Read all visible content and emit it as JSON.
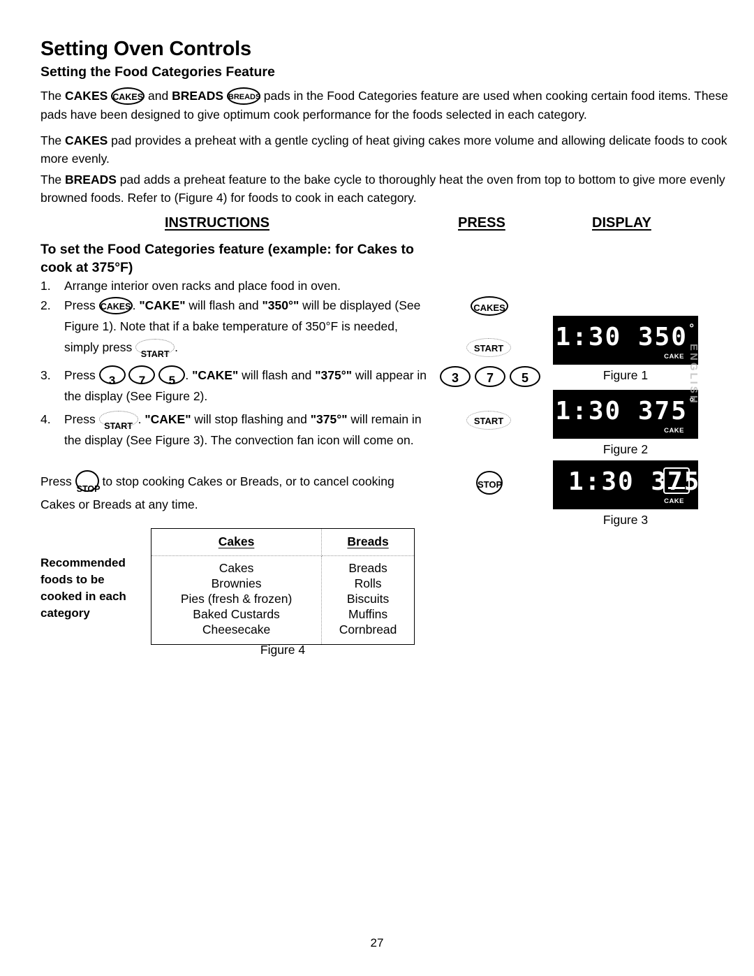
{
  "document": {
    "title": "Setting Oven Controls",
    "subtitle": "Setting the Food Categories Feature",
    "page_number": "27",
    "scan_artifact_text": "ENGLISH"
  },
  "intro": {
    "p1_a": "The ",
    "p1_cakes": "CAKES",
    "p1_pad_cakes": "CAKES",
    "p1_b": " and ",
    "p1_breads": "BREADS",
    "p1_pad_breads": "BREADS",
    "p1_c": " pads in the Food Categories feature are used when cooking certain food items. These pads have been designed to give optimum cook performance for the foods selected in each category.",
    "p2_a": "The ",
    "p2_bold": "CAKES",
    "p2_b": " pad provides a preheat with a gentle cycling of heat giving cakes more volume and allowing delicate foods to cook more evenly.",
    "p3_a": "The ",
    "p3_bold": "BREADS",
    "p3_b": " pad adds a preheat feature to the bake cycle to thoroughly heat the oven from top to bottom to give more evenly browned foods. Refer to (Figure 4) for foods to cook in each category."
  },
  "columns": {
    "instructions": "INSTRUCTIONS",
    "press": "PRESS",
    "display": "DISPLAY"
  },
  "instructions": {
    "title": "To set the Food Categories feature (example: for Cakes to cook  at 375°F)",
    "step1": {
      "num": "1.",
      "text": "Arrange interior oven racks and place food in oven."
    },
    "step2": {
      "num": "2.",
      "a": "Press ",
      "pad": "CAKES",
      "b": ". ",
      "quote1": "\"CAKE\"",
      "c": " will flash and ",
      "quote2": "\"350°\"",
      "d": " will be displayed (See Figure 1). Note that if a bake temperature of 350°F is needed, simply press ",
      "pad2": "START",
      "e": "."
    },
    "step3": {
      "num": "3.",
      "a": "Press ",
      "key1": "3",
      "key2": "7",
      "key3": "5",
      "b": ". ",
      "quote1": "\"CAKE\"",
      "c": " will flash and ",
      "quote2": "\"375°\"",
      "d": " will appear in the display (See Figure 2)."
    },
    "step4": {
      "num": "4.",
      "a": "Press ",
      "pad": "START",
      "b": ". ",
      "quote1": "\"CAKE\"",
      "c": " will stop flashing and ",
      "quote2": "\"375°\"",
      "d": "  will remain in the display (See Figure 3). The convection fan icon will come on."
    },
    "closing": {
      "a": "Press ",
      "pad": "STOP",
      "b": " to stop cooking Cakes or Breads, or to cancel cooking Cakes or Breads at any time."
    }
  },
  "press_column": {
    "cakes": "CAKES",
    "start_1": "START",
    "num_3": "3",
    "num_7": "7",
    "num_5": "5",
    "start_2": "START",
    "stop": "STOP"
  },
  "display_column": {
    "figure1": {
      "value": "1:30 350",
      "degree": "°",
      "indicator": "CAKE",
      "caption": "Figure 1",
      "fan_icon": false
    },
    "figure2": {
      "value": "1:30 375",
      "degree": "°",
      "indicator": "CAKE",
      "caption": "Figure 2",
      "fan_icon": false
    },
    "figure3": {
      "value": "1:30 375",
      "degree": "°",
      "indicator": "CAKE",
      "caption": "Figure 3",
      "fan_icon": true
    }
  },
  "figure4": {
    "row_label": "Recommended foods to be cooked in each category",
    "headers": [
      "Cakes",
      "Breads"
    ],
    "cakes_items": [
      "Cakes",
      "Brownies",
      "Pies (fresh & frozen)",
      "Baked Custards",
      "Cheesecake"
    ],
    "breads_items": [
      "Breads",
      "Rolls",
      "Biscuits",
      "Muffins",
      "Cornbread"
    ],
    "caption": "Figure 4"
  }
}
